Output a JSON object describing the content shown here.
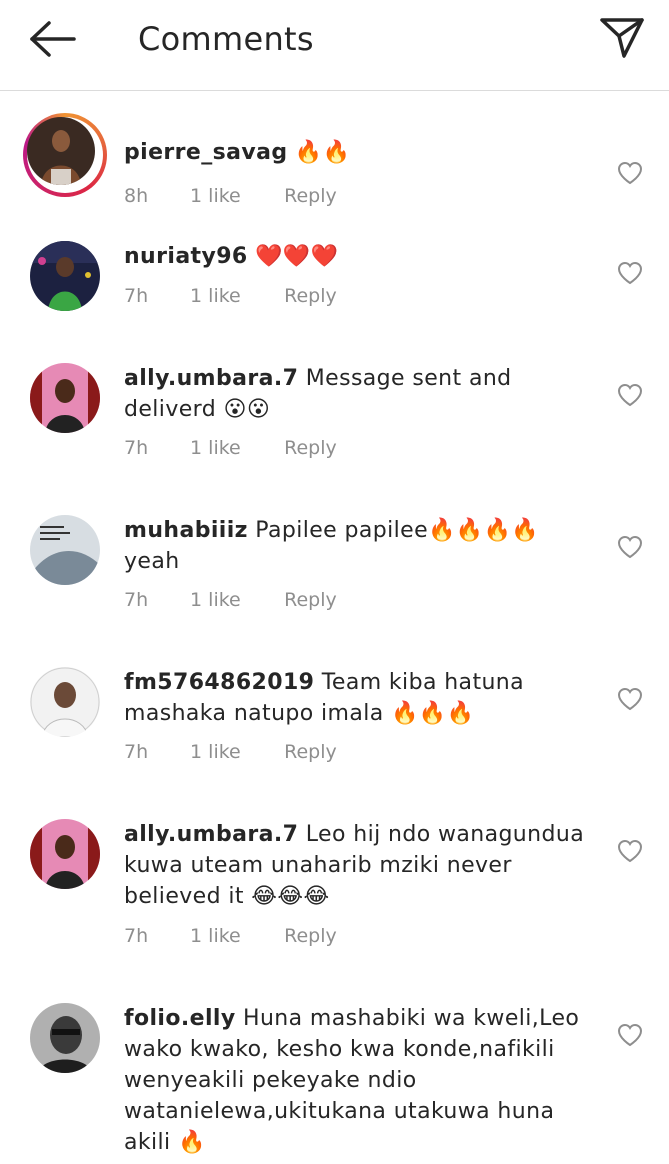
{
  "header": {
    "title": "Comments",
    "back_icon": "arrow-left-icon",
    "send_icon": "paper-plane-icon"
  },
  "comments": [
    {
      "username": "pierre_savag",
      "text": "🔥🔥",
      "time": "8h",
      "likes": "1 like",
      "reply": "Reply",
      "story_ring": true
    },
    {
      "username": "nuriaty96",
      "text": "❤️❤️❤️",
      "time": "7h",
      "likes": "1 like",
      "reply": "Reply"
    },
    {
      "username": "ally.umbara.7",
      "text": "Message sent and deliverd 😮😮",
      "time": "7h",
      "likes": "1 like",
      "reply": "Reply"
    },
    {
      "username": "muhabiiiz",
      "text": "Papilee papilee🔥🔥🔥🔥 yeah",
      "time": "7h",
      "likes": "1 like",
      "reply": "Reply"
    },
    {
      "username": "fm5764862019",
      "text": "Team kiba hatuna mashaka natupo imala 🔥🔥🔥",
      "time": "7h",
      "likes": "1 like",
      "reply": "Reply"
    },
    {
      "username": "ally.umbara.7",
      "text": "Leo hij ndo wanagundua kuwa uteam unaharib mziki never believed it 😂😂😂",
      "time": "7h",
      "likes": "1 like",
      "reply": "Reply"
    },
    {
      "username": "folio.elly",
      "text": "Huna mashabiki wa kweli,Leo wako kwako, kesho kwa konde,nafikili wenyeakili pekeyake ndio watanielewa,ukitukana utakuwa huna akili 🔥",
      "time": "",
      "likes": "",
      "reply": ""
    }
  ],
  "icons": {
    "like": "heart-outline-icon"
  },
  "colors": {
    "text": "#262626",
    "meta": "#8e8e8e",
    "divider": "#dbdbdb",
    "story_ring": "#e1306c"
  }
}
